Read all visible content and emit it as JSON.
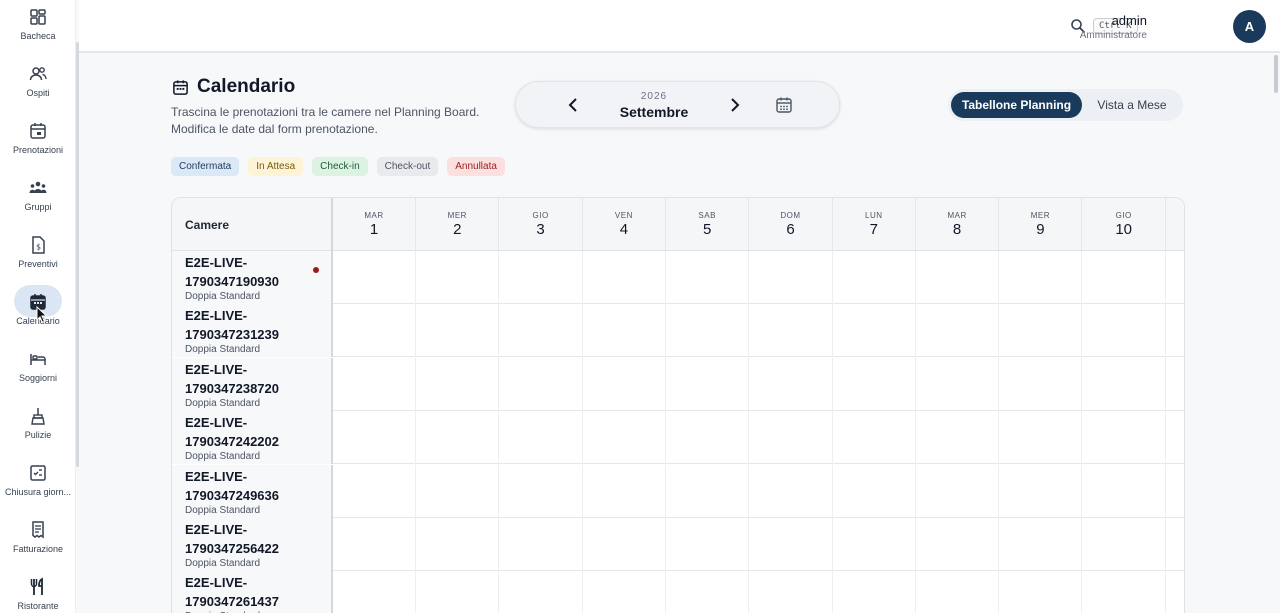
{
  "sidebar": {
    "items": [
      {
        "label": "Bacheca",
        "icon": "dashboard-icon"
      },
      {
        "label": "Ospiti",
        "icon": "guests-icon"
      },
      {
        "label": "Prenotazioni",
        "icon": "booking-icon"
      },
      {
        "label": "Gruppi",
        "icon": "groups-icon"
      },
      {
        "label": "Preventivi",
        "icon": "quote-icon"
      },
      {
        "label": "Calendario",
        "icon": "calendar-icon"
      },
      {
        "label": "Soggiorni",
        "icon": "bed-icon"
      },
      {
        "label": "Pulizie",
        "icon": "broom-icon"
      },
      {
        "label": "Chiusura giorn...",
        "icon": "checklist-icon"
      },
      {
        "label": "Fatturazione",
        "icon": "invoice-icon"
      },
      {
        "label": "Ristorante",
        "icon": "restaurant-icon"
      }
    ],
    "active_index": 5
  },
  "topbar": {
    "shortcut": "Ctrl K",
    "user_name": "admin",
    "user_role": "Amministratore",
    "avatar_initial": "A"
  },
  "header": {
    "title": "Calendario",
    "subtitle_line1": "Trascina le prenotazioni tra le camere nel Planning Board.",
    "subtitle_line2": "Modifica le date dal form prenotazione."
  },
  "month_nav": {
    "year": "2026",
    "month": "Settembre"
  },
  "view_toggle": {
    "active_label": "Tabellone Planning",
    "inactive_label": "Vista a Mese"
  },
  "legend": [
    {
      "label": "Confermata",
      "bg": "#dbe8f6",
      "fg": "#1e3a5f"
    },
    {
      "label": "In Attesa",
      "bg": "#fdf3d6",
      "fg": "#7a5a0a"
    },
    {
      "label": "Check-in",
      "bg": "#dcf2e3",
      "fg": "#1e5e3a"
    },
    {
      "label": "Check-out",
      "bg": "#e8eaed",
      "fg": "#4b5563"
    },
    {
      "label": "Annullata",
      "bg": "#fbe0e0",
      "fg": "#9b1c1c"
    }
  ],
  "board": {
    "rooms_header": "Camere",
    "days": [
      {
        "name": "MAR",
        "num": "1"
      },
      {
        "name": "MER",
        "num": "2"
      },
      {
        "name": "GIO",
        "num": "3"
      },
      {
        "name": "VEN",
        "num": "4"
      },
      {
        "name": "SAB",
        "num": "5"
      },
      {
        "name": "DOM",
        "num": "6"
      },
      {
        "name": "LUN",
        "num": "7"
      },
      {
        "name": "MAR",
        "num": "8"
      },
      {
        "name": "MER",
        "num": "9"
      },
      {
        "name": "GIO",
        "num": "10"
      }
    ],
    "rooms": [
      {
        "code_line1": "E2E-LIVE-",
        "code_line2": "1790347190930",
        "type": "Doppia Standard",
        "flag": true
      },
      {
        "code_line1": "E2E-LIVE-",
        "code_line2": "1790347231239",
        "type": "Doppia Standard",
        "flag": false
      },
      {
        "code_line1": "E2E-LIVE-",
        "code_line2": "1790347238720",
        "type": "Doppia Standard",
        "flag": false
      },
      {
        "code_line1": "E2E-LIVE-",
        "code_line2": "1790347242202",
        "type": "Doppia Standard",
        "flag": false
      },
      {
        "code_line1": "E2E-LIVE-",
        "code_line2": "1790347249636",
        "type": "Doppia Standard",
        "flag": false
      },
      {
        "code_line1": "E2E-LIVE-",
        "code_line2": "1790347256422",
        "type": "Doppia Standard",
        "flag": false
      },
      {
        "code_line1": "E2E-LIVE-",
        "code_line2": "1790347261437",
        "type": "Doppia Standard",
        "flag": false
      }
    ]
  }
}
